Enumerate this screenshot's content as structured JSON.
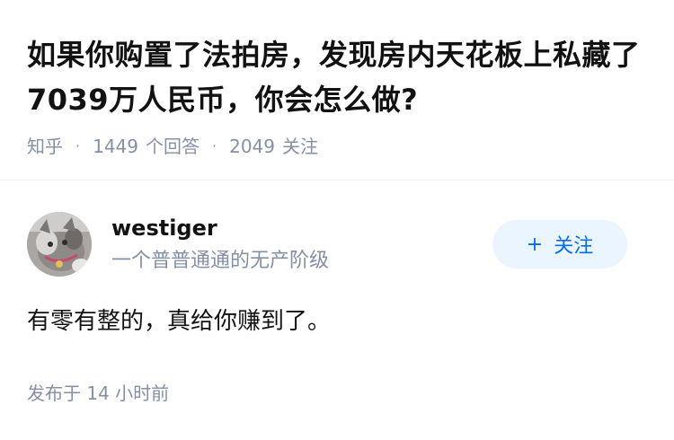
{
  "question": {
    "title": "如果你购置了法拍房，发现房内天花板上私藏了7039万人民币，你会怎么做?",
    "source": "知乎",
    "answer_count": "1449",
    "answer_label": "个回答",
    "follower_count": "2049",
    "follower_label": "关注",
    "separator": "·"
  },
  "author": {
    "name": "westiger",
    "bio": "一个普普通通的无产阶级",
    "avatar_icon": "avatar-cat-photo",
    "follow_label": "关注",
    "follow_icon": "plus-icon"
  },
  "answer": {
    "content": "有零有整的，真给你赚到了。",
    "time_prefix": "发布于",
    "time_value": "14 小时前"
  },
  "colors": {
    "title": "#121212",
    "meta": "#8590a6",
    "follow_bg": "#ebf5ff",
    "follow_text": "#056de8"
  }
}
